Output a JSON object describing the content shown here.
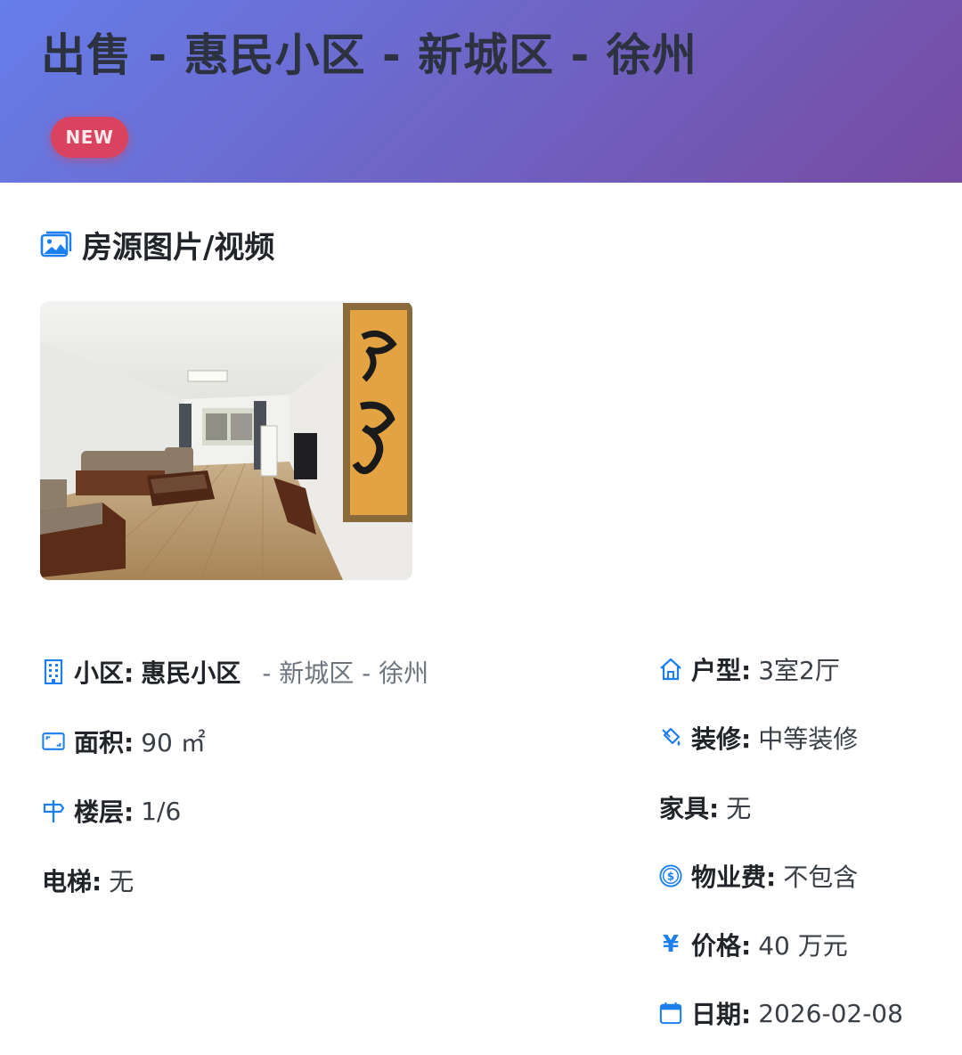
{
  "header": {
    "title": "出售 - 惠民小区 - 新城区 - 徐州",
    "badge": "NEW"
  },
  "media_section": {
    "heading": "房源图片/视频",
    "icon": "images-icon"
  },
  "details_left": {
    "community": {
      "label": "小区:",
      "value": "惠民小区",
      "location": "- 新城区 - 徐州",
      "icon": "building-icon"
    },
    "area": {
      "label": "面积:",
      "value": "90 ㎡",
      "icon": "area-icon"
    },
    "floor": {
      "label": "楼层:",
      "value": "1/6",
      "icon": "signpost-icon"
    },
    "elevator": {
      "label": "电梯:",
      "value": "无"
    }
  },
  "details_right": {
    "layout": {
      "label": "户型:",
      "value": "3室2厅",
      "icon": "house-icon"
    },
    "decoration": {
      "label": "装修:",
      "value": "中等装修",
      "icon": "paint-bucket-icon"
    },
    "furniture": {
      "label": "家具:",
      "value": "无"
    },
    "property_fee": {
      "label": "物业费:",
      "value": "不包含",
      "icon": "dollar-circle-icon"
    },
    "price": {
      "label": "价格:",
      "value": "40 万元",
      "symbol": "¥",
      "icon": "yen-icon"
    },
    "date": {
      "label": "日期:",
      "value": "2026-02-08",
      "icon": "calendar-icon"
    }
  },
  "colors": {
    "header_gradient_start": "#667eea",
    "header_gradient_end": "#764ba2",
    "badge": "#d9435f",
    "icon_accent": "#1c7ff0"
  }
}
